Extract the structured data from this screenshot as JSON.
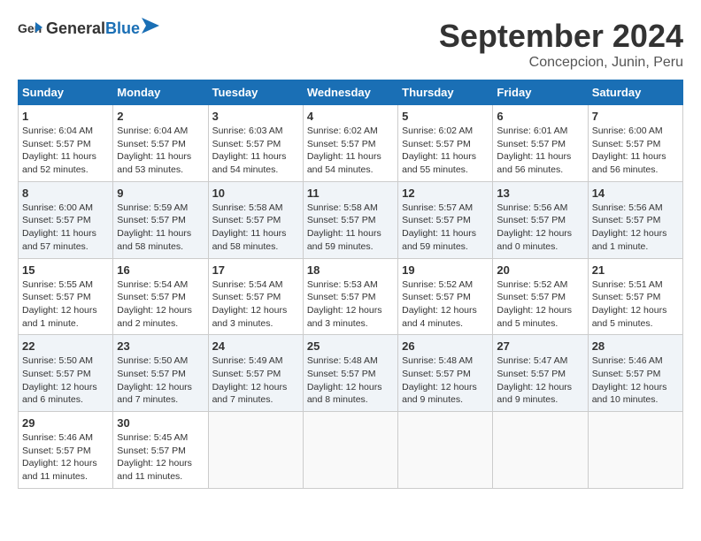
{
  "header": {
    "logo": {
      "general": "General",
      "blue": "Blue"
    },
    "title": "September 2024",
    "location": "Concepcion, Junin, Peru"
  },
  "calendar": {
    "weekdays": [
      "Sunday",
      "Monday",
      "Tuesday",
      "Wednesday",
      "Thursday",
      "Friday",
      "Saturday"
    ],
    "weeks": [
      [
        null,
        {
          "day": "2",
          "sunrise": "6:04 AM",
          "sunset": "5:57 PM",
          "daylight": "11 hours and 53 minutes."
        },
        {
          "day": "3",
          "sunrise": "6:03 AM",
          "sunset": "5:57 PM",
          "daylight": "11 hours and 54 minutes."
        },
        {
          "day": "4",
          "sunrise": "6:02 AM",
          "sunset": "5:57 PM",
          "daylight": "11 hours and 54 minutes."
        },
        {
          "day": "5",
          "sunrise": "6:02 AM",
          "sunset": "5:57 PM",
          "daylight": "11 hours and 55 minutes."
        },
        {
          "day": "6",
          "sunrise": "6:01 AM",
          "sunset": "5:57 PM",
          "daylight": "11 hours and 56 minutes."
        },
        {
          "day": "7",
          "sunrise": "6:00 AM",
          "sunset": "5:57 PM",
          "daylight": "11 hours and 56 minutes."
        }
      ],
      [
        {
          "day": "1",
          "sunrise": "6:04 AM",
          "sunset": "5:57 PM",
          "daylight": "11 hours and 52 minutes."
        },
        {
          "day": "9",
          "sunrise": "5:59 AM",
          "sunset": "5:57 PM",
          "daylight": "11 hours and 58 minutes."
        },
        {
          "day": "10",
          "sunrise": "5:58 AM",
          "sunset": "5:57 PM",
          "daylight": "11 hours and 58 minutes."
        },
        {
          "day": "11",
          "sunrise": "5:58 AM",
          "sunset": "5:57 PM",
          "daylight": "11 hours and 59 minutes."
        },
        {
          "day": "12",
          "sunrise": "5:57 AM",
          "sunset": "5:57 PM",
          "daylight": "11 hours and 59 minutes."
        },
        {
          "day": "13",
          "sunrise": "5:56 AM",
          "sunset": "5:57 PM",
          "daylight": "12 hours and 0 minutes."
        },
        {
          "day": "14",
          "sunrise": "5:56 AM",
          "sunset": "5:57 PM",
          "daylight": "12 hours and 1 minute."
        }
      ],
      [
        {
          "day": "8",
          "sunrise": "6:00 AM",
          "sunset": "5:57 PM",
          "daylight": "11 hours and 57 minutes."
        },
        {
          "day": "16",
          "sunrise": "5:54 AM",
          "sunset": "5:57 PM",
          "daylight": "12 hours and 2 minutes."
        },
        {
          "day": "17",
          "sunrise": "5:54 AM",
          "sunset": "5:57 PM",
          "daylight": "12 hours and 3 minutes."
        },
        {
          "day": "18",
          "sunrise": "5:53 AM",
          "sunset": "5:57 PM",
          "daylight": "12 hours and 3 minutes."
        },
        {
          "day": "19",
          "sunrise": "5:52 AM",
          "sunset": "5:57 PM",
          "daylight": "12 hours and 4 minutes."
        },
        {
          "day": "20",
          "sunrise": "5:52 AM",
          "sunset": "5:57 PM",
          "daylight": "12 hours and 5 minutes."
        },
        {
          "day": "21",
          "sunrise": "5:51 AM",
          "sunset": "5:57 PM",
          "daylight": "12 hours and 5 minutes."
        }
      ],
      [
        {
          "day": "15",
          "sunrise": "5:55 AM",
          "sunset": "5:57 PM",
          "daylight": "12 hours and 1 minute."
        },
        {
          "day": "23",
          "sunrise": "5:50 AM",
          "sunset": "5:57 PM",
          "daylight": "12 hours and 7 minutes."
        },
        {
          "day": "24",
          "sunrise": "5:49 AM",
          "sunset": "5:57 PM",
          "daylight": "12 hours and 7 minutes."
        },
        {
          "day": "25",
          "sunrise": "5:48 AM",
          "sunset": "5:57 PM",
          "daylight": "12 hours and 8 minutes."
        },
        {
          "day": "26",
          "sunrise": "5:48 AM",
          "sunset": "5:57 PM",
          "daylight": "12 hours and 9 minutes."
        },
        {
          "day": "27",
          "sunrise": "5:47 AM",
          "sunset": "5:57 PM",
          "daylight": "12 hours and 9 minutes."
        },
        {
          "day": "28",
          "sunrise": "5:46 AM",
          "sunset": "5:57 PM",
          "daylight": "12 hours and 10 minutes."
        }
      ],
      [
        {
          "day": "22",
          "sunrise": "5:50 AM",
          "sunset": "5:57 PM",
          "daylight": "12 hours and 6 minutes."
        },
        {
          "day": "30",
          "sunrise": "5:45 AM",
          "sunset": "5:57 PM",
          "daylight": "12 hours and 11 minutes."
        },
        null,
        null,
        null,
        null,
        null
      ],
      [
        {
          "day": "29",
          "sunrise": "5:46 AM",
          "sunset": "5:57 PM",
          "daylight": "12 hours and 11 minutes."
        },
        null,
        null,
        null,
        null,
        null,
        null
      ]
    ]
  }
}
